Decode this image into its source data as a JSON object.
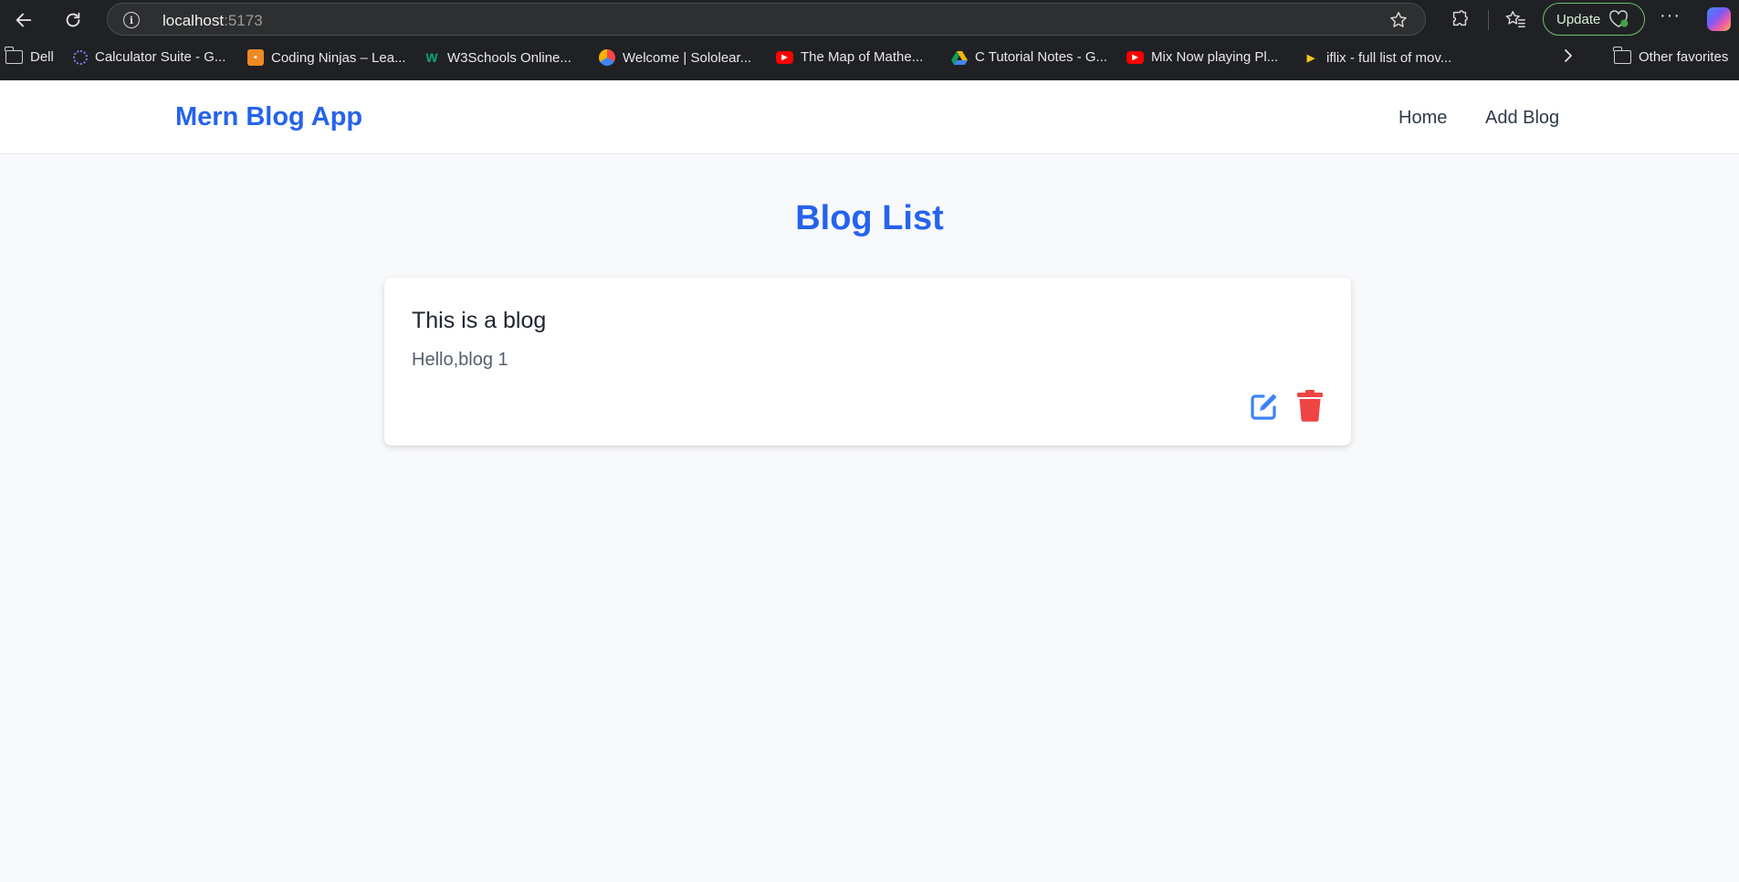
{
  "browser": {
    "url_host": "localhost",
    "url_port": ":5173",
    "update_label": "Update",
    "bookmarks": [
      {
        "label": "Dell",
        "icon": "folder-icon"
      },
      {
        "label": "Calculator Suite - G...",
        "icon": "calculator-suite-icon"
      },
      {
        "label": "Coding Ninjas – Lea...",
        "icon": "coding-ninjas-icon"
      },
      {
        "label": "W3Schools Online...",
        "icon": "w3schools-icon"
      },
      {
        "label": "Welcome | Sololear...",
        "icon": "sololearn-icon"
      },
      {
        "label": "The Map of Mathe...",
        "icon": "youtube-icon"
      },
      {
        "label": "C Tutorial Notes - G...",
        "icon": "google-drive-icon"
      },
      {
        "label": "Mix Now playing Pl...",
        "icon": "youtube-icon"
      },
      {
        "label": "iflix - full list of mov...",
        "icon": "iflix-icon"
      }
    ],
    "other_favorites": "Other favorites"
  },
  "app": {
    "brand": "Mern Blog App",
    "nav": [
      {
        "label": "Home"
      },
      {
        "label": "Add Blog"
      }
    ],
    "page_title": "Blog List",
    "blogs": [
      {
        "title": "This is a blog",
        "content": "Hello,blog 1"
      }
    ]
  },
  "colors": {
    "accent": "#2563eb",
    "delete": "#ef4444",
    "edit": "#3b82f6",
    "update_border": "#6fbf73"
  }
}
